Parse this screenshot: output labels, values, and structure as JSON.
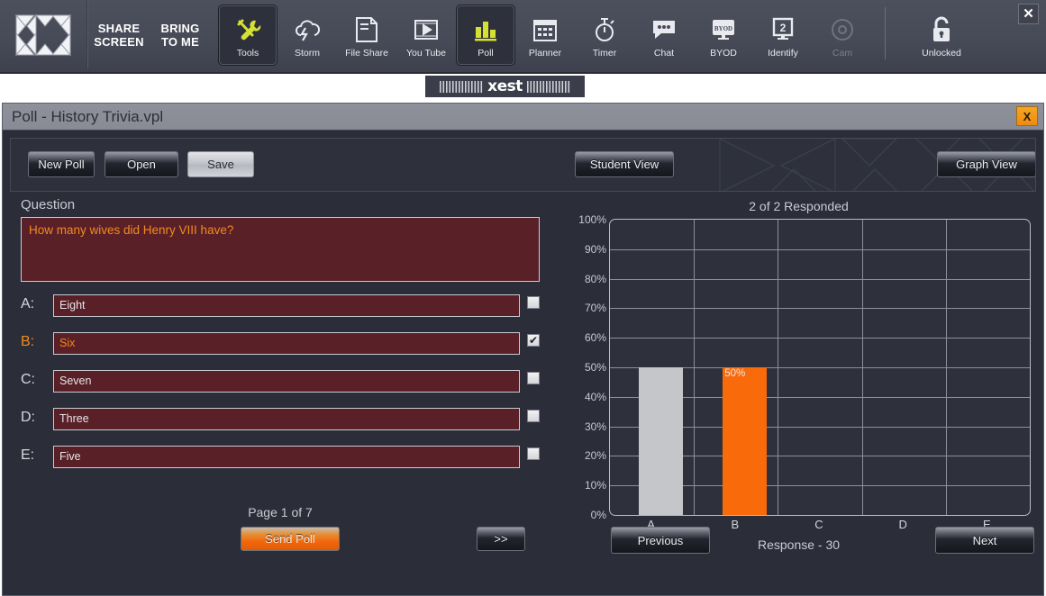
{
  "toolbar": {
    "logo_icon": "xest-x-logo",
    "text_buttons": [
      {
        "line1": "SHARE",
        "line2": "SCREEN",
        "name": "share-screen"
      },
      {
        "line1": "BRING",
        "line2": "TO ME",
        "name": "bring-to-me"
      }
    ],
    "buttons": [
      {
        "label": "Tools",
        "icon": "tools-icon",
        "active": true,
        "dim": false
      },
      {
        "label": "Storm",
        "icon": "storm-icon",
        "active": false,
        "dim": false
      },
      {
        "label": "File Share",
        "icon": "file-share-icon",
        "active": false,
        "dim": false
      },
      {
        "label": "You Tube",
        "icon": "youtube-icon",
        "active": false,
        "dim": false
      },
      {
        "label": "Poll",
        "icon": "poll-icon",
        "active": true,
        "dim": false
      },
      {
        "label": "Planner",
        "icon": "planner-icon",
        "active": false,
        "dim": false
      },
      {
        "label": "Timer",
        "icon": "timer-icon",
        "active": false,
        "dim": false
      },
      {
        "label": "Chat",
        "icon": "chat-icon",
        "active": false,
        "dim": false
      },
      {
        "label": "BYOD",
        "icon": "byod-icon",
        "active": false,
        "dim": false
      },
      {
        "label": "Identify",
        "icon": "identify-icon",
        "active": false,
        "dim": false
      },
      {
        "label": "Cam",
        "icon": "cam-icon",
        "active": false,
        "dim": true
      }
    ],
    "lock": {
      "label": "Unlocked",
      "icon": "unlocked-padlock-icon"
    },
    "close_label": "✕"
  },
  "watermark": {
    "wordmark": "xest"
  },
  "window": {
    "title": "Poll - History Trivia.vpl",
    "close_label": "X"
  },
  "actionbar": {
    "new_poll": "New Poll",
    "open": "Open",
    "save": "Save",
    "student_view": "Student View",
    "graph_view": "Graph View"
  },
  "question_panel": {
    "label": "Question",
    "text": "How many wives did Henry VIII have?",
    "answers": [
      {
        "key": "A:",
        "value": "Eight",
        "checked": false
      },
      {
        "key": "B:",
        "value": "Six",
        "checked": true
      },
      {
        "key": "C:",
        "value": "Seven",
        "checked": false
      },
      {
        "key": "D:",
        "value": "Three",
        "checked": false
      },
      {
        "key": "E:",
        "value": "Five",
        "checked": false
      }
    ],
    "checkmark": "✔",
    "page_indicator": "Page 1 of 7",
    "send_poll": "Send Poll",
    "next_page": ">>"
  },
  "chart_data": {
    "type": "bar",
    "title": "2 of 2 Responded",
    "categories": [
      "A",
      "B",
      "C",
      "D",
      "E"
    ],
    "values": [
      50,
      50,
      0,
      0,
      0
    ],
    "bar_labels": [
      "",
      "50%",
      "",
      "",
      ""
    ],
    "colors": [
      "#c4c6ca",
      "#f96a0b",
      "#f96a0b",
      "#f96a0b",
      "#f96a0b"
    ],
    "xlabel": "",
    "ylabel": "",
    "ylim": [
      0,
      100
    ],
    "ytick_labels": [
      "100%",
      "90%",
      "80%",
      "70%",
      "60%",
      "50%",
      "40%",
      "30%",
      "20%",
      "10%",
      "0%"
    ],
    "grid": true,
    "legend": "none"
  },
  "chart_panel": {
    "response_label": "Response - 30",
    "previous": "Previous",
    "next": "Next"
  },
  "colors": {
    "accent_orange": "#f96a0b",
    "toolbar_bg": "#474a57",
    "panel_bg": "#2e313c",
    "field_maroon": "#5a2027",
    "icon_yellow": "#d4e132"
  }
}
